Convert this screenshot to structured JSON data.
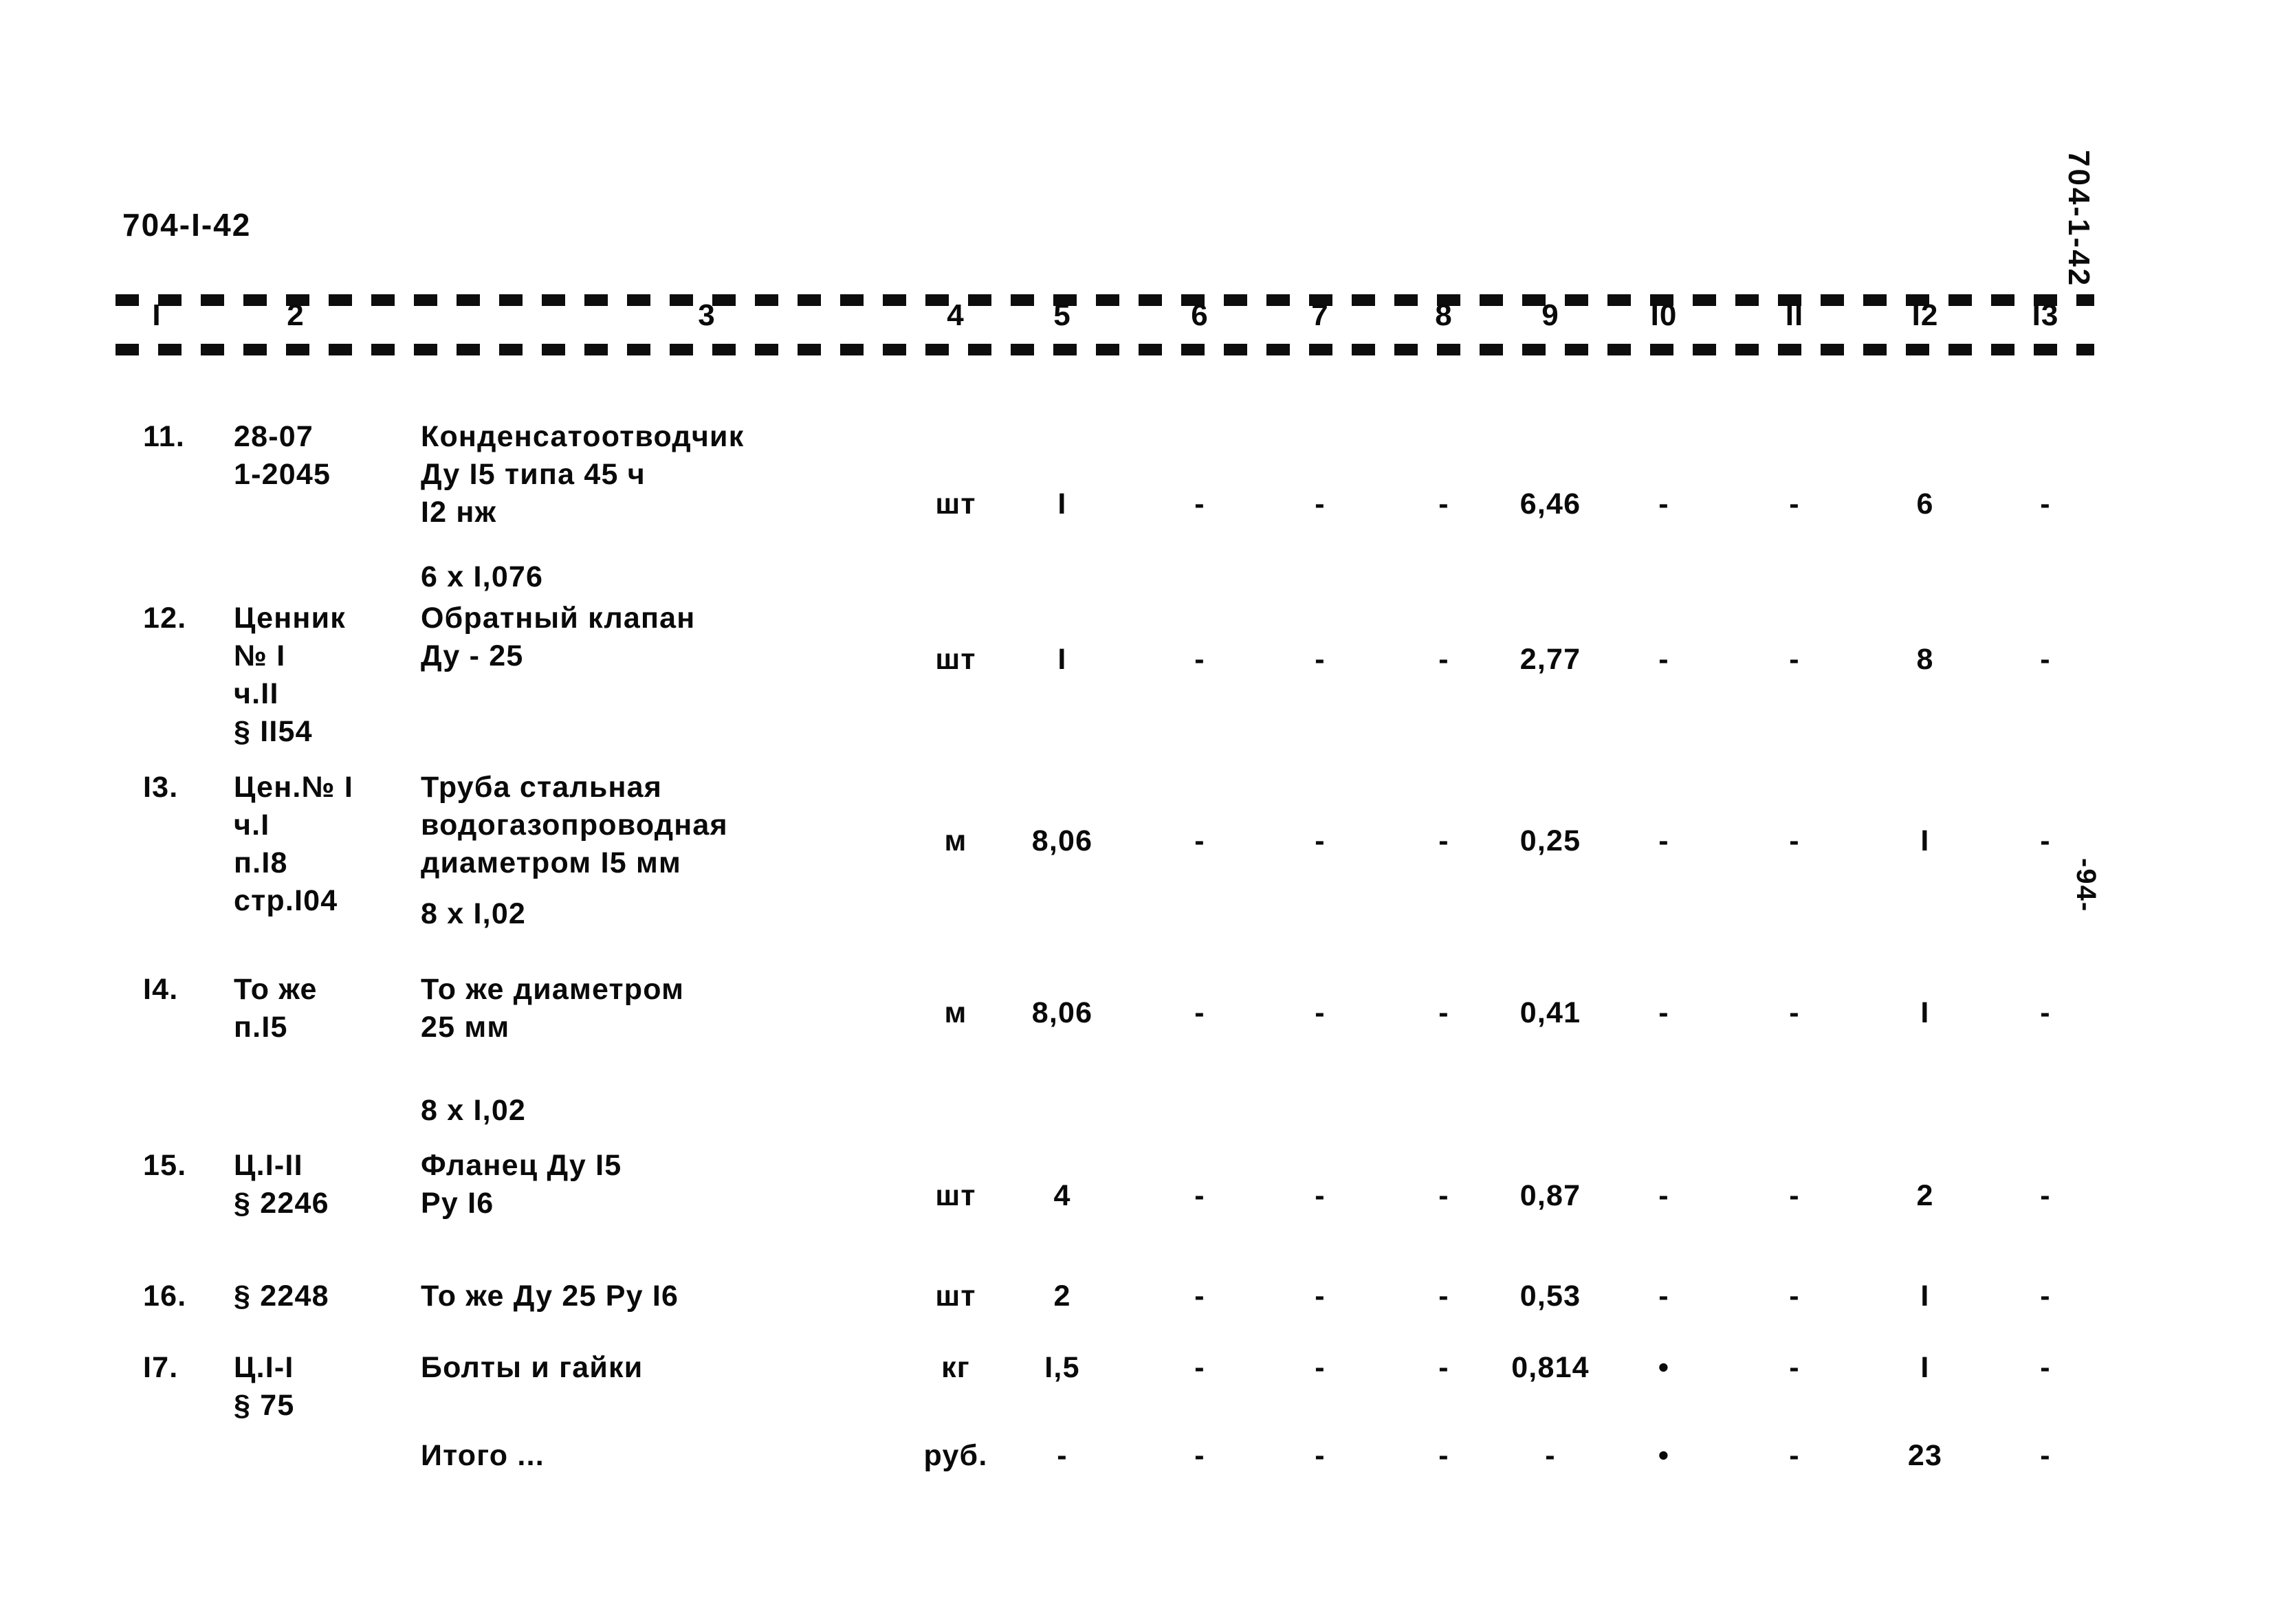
{
  "document": {
    "code": "704-I-42",
    "margin_code": "704-1-42",
    "page_number": "-94-"
  },
  "table": {
    "column_headers": [
      "I",
      "2",
      "3",
      "4",
      "5",
      "6",
      "7",
      "8",
      "9",
      "I0",
      "II",
      "I2",
      "I3"
    ],
    "rows": [
      {
        "no": "11.",
        "justification": [
          "28-07",
          "1-2045"
        ],
        "name": [
          "Конденсатоотводчик",
          "Ду I5 типа 45 ч",
          "I2 нж"
        ],
        "multiplier": "6 x I,076",
        "unit": "шт",
        "quantity": "I",
        "c6": "-",
        "c7": "-",
        "c8": "-",
        "c9": "6,46",
        "c10": "-",
        "c11": "-",
        "c12": "6",
        "c13": "-"
      },
      {
        "no": "12.",
        "justification": [
          "Ценник",
          "№ I",
          "ч.II",
          "§ II54"
        ],
        "name": [
          "Обратный клапан",
          "Ду - 25"
        ],
        "multiplier": "",
        "unit": "шт",
        "quantity": "I",
        "c6": "-",
        "c7": "-",
        "c8": "-",
        "c9": "2,77",
        "c10": "-",
        "c11": "-",
        "c12": "8",
        "c13": "-"
      },
      {
        "no": "I3.",
        "justification": [
          "Цен.№ I",
          "ч.I",
          "п.I8",
          "стр.I04"
        ],
        "name": [
          "Труба стальная",
          "водогазопроводная",
          "диаметром I5 мм"
        ],
        "multiplier": "8 x I,02",
        "unit": "м",
        "quantity": "8,06",
        "c6": "-",
        "c7": "-",
        "c8": "-",
        "c9": "0,25",
        "c10": "-",
        "c11": "-",
        "c12": "I",
        "c13": "-"
      },
      {
        "no": "I4.",
        "justification": [
          "То же",
          "п.I5"
        ],
        "name": [
          "То же диаметром",
          "25 мм"
        ],
        "multiplier": "8 x I,02",
        "unit": "м",
        "quantity": "8,06",
        "c6": "-",
        "c7": "-",
        "c8": "-",
        "c9": "0,41",
        "c10": "-",
        "c11": "-",
        "c12": "I",
        "c13": "-"
      },
      {
        "no": "15.",
        "justification": [
          "Ц.I-II",
          "§ 2246"
        ],
        "name": [
          "Фланец Ду I5",
          "Ру I6"
        ],
        "multiplier": "",
        "unit": "шт",
        "quantity": "4",
        "c6": "-",
        "c7": "-",
        "c8": "-",
        "c9": "0,87",
        "c10": "-",
        "c11": "-",
        "c12": "2",
        "c13": "-"
      },
      {
        "no": "16.",
        "justification": [
          "§ 2248"
        ],
        "name": [
          "То же Ду 25 Ру I6"
        ],
        "multiplier": "",
        "unit": "шт",
        "quantity": "2",
        "c6": "-",
        "c7": "-",
        "c8": "-",
        "c9": "0,53",
        "c10": "-",
        "c11": "-",
        "c12": "I",
        "c13": "-"
      },
      {
        "no": "I7.",
        "justification": [
          "Ц.I-I",
          "§ 75"
        ],
        "name": [
          "Болты и гайки"
        ],
        "multiplier": "",
        "unit": "кг",
        "quantity": "I,5",
        "c6": "-",
        "c7": "-",
        "c8": "-",
        "c9": "0,814",
        "c10": "•",
        "c11": "-",
        "c12": "I",
        "c13": "-"
      }
    ],
    "total": {
      "label": "Итого ...",
      "unit": "руб.",
      "c5": "-",
      "c6": "-",
      "c7": "-",
      "c8": "-",
      "c9": "-",
      "c10": "•",
      "c11": "-",
      "c12": "23",
      "c13": "-"
    }
  }
}
